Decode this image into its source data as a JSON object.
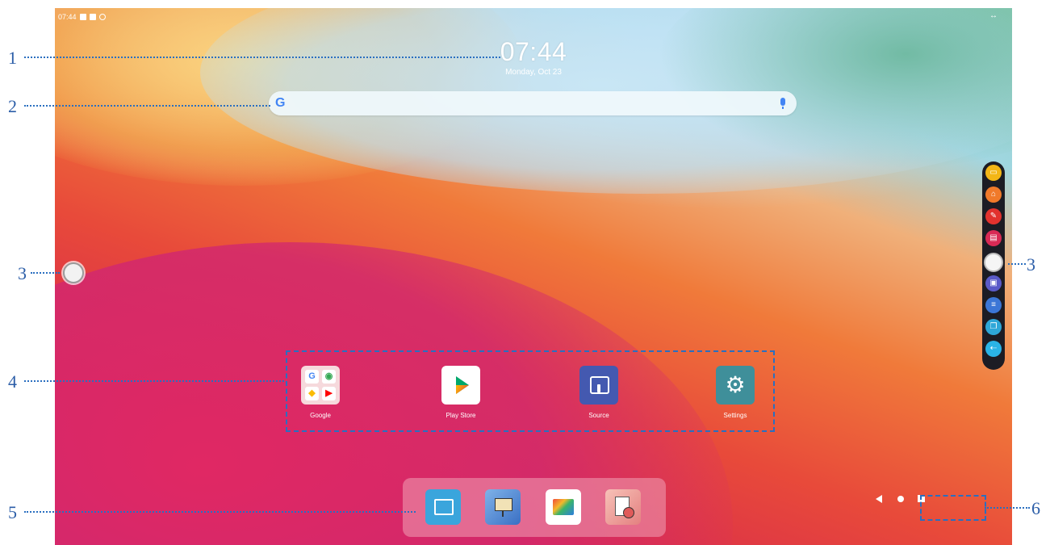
{
  "status_bar": {
    "time": "07:44",
    "right_icon": "↔",
    "icons": [
      "sim-icon",
      "storage-icon",
      "sync-icon"
    ]
  },
  "clock": {
    "time": "07:44",
    "date": "Monday, Oct 23"
  },
  "search": {
    "logo": "G",
    "logo_icon": "google-icon",
    "mic_icon": "mic-icon"
  },
  "floating_button": {
    "icon": "circle-icon"
  },
  "sidebar": [
    {
      "icon": "whiteboard-icon",
      "color": "#f3b616"
    },
    {
      "icon": "home-icon",
      "color": "#f07a2a"
    },
    {
      "icon": "annotate-icon",
      "color": "#e2322e"
    },
    {
      "icon": "present-icon",
      "color": "#d92a55"
    },
    {
      "icon": "circle-icon",
      "color": "#f5f5f5"
    },
    {
      "icon": "toolbox-icon",
      "color": "#5a5ac8"
    },
    {
      "icon": "sliders-icon",
      "color": "#3b76d6"
    },
    {
      "icon": "windows-icon",
      "color": "#2ea7d8"
    },
    {
      "icon": "exit-icon",
      "color": "#2ab3e6"
    }
  ],
  "apps": [
    {
      "label": "Google",
      "icon": "google-folder-icon"
    },
    {
      "label": "Play Store",
      "icon": "play-store-icon"
    },
    {
      "label": "Source",
      "icon": "source-icon"
    },
    {
      "label": "Settings",
      "icon": "gear-icon"
    }
  ],
  "google_folder": [
    "G",
    "◉",
    "◆",
    "▶"
  ],
  "dock": [
    {
      "icon": "cast-icon",
      "color": "#3aa5dc"
    },
    {
      "icon": "whiteboard-easel-icon",
      "color": "#4a7fd0"
    },
    {
      "icon": "gallery-icon",
      "color": "#ffffff"
    },
    {
      "icon": "file-manager-icon",
      "color": "#f0a6a6"
    }
  ],
  "nav": {
    "back_icon": "back-icon",
    "home_icon": "home-dot-icon",
    "recents_icon": "recents-icon"
  },
  "callouts": [
    "1",
    "2",
    "3",
    "3",
    "4",
    "5",
    "6"
  ],
  "colors": {
    "callout": "#2a6fc0"
  }
}
